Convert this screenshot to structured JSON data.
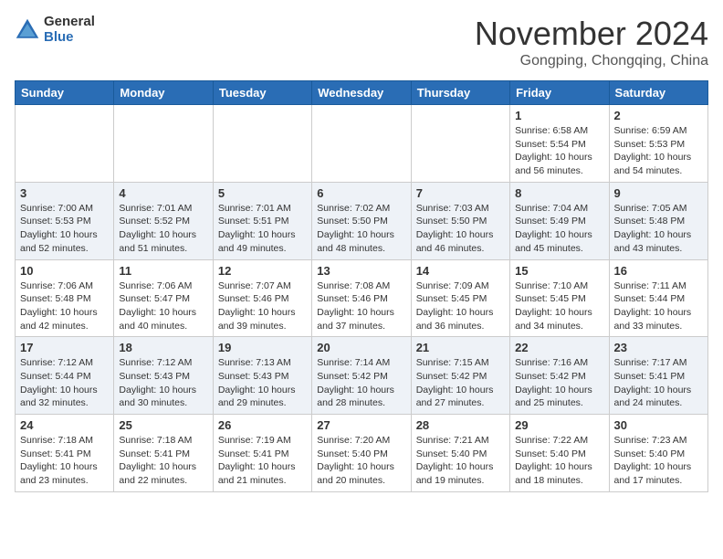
{
  "header": {
    "logo_general": "General",
    "logo_blue": "Blue",
    "month_title": "November 2024",
    "location": "Gongping, Chongqing, China"
  },
  "days_of_week": [
    "Sunday",
    "Monday",
    "Tuesday",
    "Wednesday",
    "Thursday",
    "Friday",
    "Saturday"
  ],
  "weeks": [
    {
      "alt": false,
      "days": [
        {
          "num": "",
          "info": ""
        },
        {
          "num": "",
          "info": ""
        },
        {
          "num": "",
          "info": ""
        },
        {
          "num": "",
          "info": ""
        },
        {
          "num": "",
          "info": ""
        },
        {
          "num": "1",
          "info": "Sunrise: 6:58 AM\nSunset: 5:54 PM\nDaylight: 10 hours and 56 minutes."
        },
        {
          "num": "2",
          "info": "Sunrise: 6:59 AM\nSunset: 5:53 PM\nDaylight: 10 hours and 54 minutes."
        }
      ]
    },
    {
      "alt": true,
      "days": [
        {
          "num": "3",
          "info": "Sunrise: 7:00 AM\nSunset: 5:53 PM\nDaylight: 10 hours and 52 minutes."
        },
        {
          "num": "4",
          "info": "Sunrise: 7:01 AM\nSunset: 5:52 PM\nDaylight: 10 hours and 51 minutes."
        },
        {
          "num": "5",
          "info": "Sunrise: 7:01 AM\nSunset: 5:51 PM\nDaylight: 10 hours and 49 minutes."
        },
        {
          "num": "6",
          "info": "Sunrise: 7:02 AM\nSunset: 5:50 PM\nDaylight: 10 hours and 48 minutes."
        },
        {
          "num": "7",
          "info": "Sunrise: 7:03 AM\nSunset: 5:50 PM\nDaylight: 10 hours and 46 minutes."
        },
        {
          "num": "8",
          "info": "Sunrise: 7:04 AM\nSunset: 5:49 PM\nDaylight: 10 hours and 45 minutes."
        },
        {
          "num": "9",
          "info": "Sunrise: 7:05 AM\nSunset: 5:48 PM\nDaylight: 10 hours and 43 minutes."
        }
      ]
    },
    {
      "alt": false,
      "days": [
        {
          "num": "10",
          "info": "Sunrise: 7:06 AM\nSunset: 5:48 PM\nDaylight: 10 hours and 42 minutes."
        },
        {
          "num": "11",
          "info": "Sunrise: 7:06 AM\nSunset: 5:47 PM\nDaylight: 10 hours and 40 minutes."
        },
        {
          "num": "12",
          "info": "Sunrise: 7:07 AM\nSunset: 5:46 PM\nDaylight: 10 hours and 39 minutes."
        },
        {
          "num": "13",
          "info": "Sunrise: 7:08 AM\nSunset: 5:46 PM\nDaylight: 10 hours and 37 minutes."
        },
        {
          "num": "14",
          "info": "Sunrise: 7:09 AM\nSunset: 5:45 PM\nDaylight: 10 hours and 36 minutes."
        },
        {
          "num": "15",
          "info": "Sunrise: 7:10 AM\nSunset: 5:45 PM\nDaylight: 10 hours and 34 minutes."
        },
        {
          "num": "16",
          "info": "Sunrise: 7:11 AM\nSunset: 5:44 PM\nDaylight: 10 hours and 33 minutes."
        }
      ]
    },
    {
      "alt": true,
      "days": [
        {
          "num": "17",
          "info": "Sunrise: 7:12 AM\nSunset: 5:44 PM\nDaylight: 10 hours and 32 minutes."
        },
        {
          "num": "18",
          "info": "Sunrise: 7:12 AM\nSunset: 5:43 PM\nDaylight: 10 hours and 30 minutes."
        },
        {
          "num": "19",
          "info": "Sunrise: 7:13 AM\nSunset: 5:43 PM\nDaylight: 10 hours and 29 minutes."
        },
        {
          "num": "20",
          "info": "Sunrise: 7:14 AM\nSunset: 5:42 PM\nDaylight: 10 hours and 28 minutes."
        },
        {
          "num": "21",
          "info": "Sunrise: 7:15 AM\nSunset: 5:42 PM\nDaylight: 10 hours and 27 minutes."
        },
        {
          "num": "22",
          "info": "Sunrise: 7:16 AM\nSunset: 5:42 PM\nDaylight: 10 hours and 25 minutes."
        },
        {
          "num": "23",
          "info": "Sunrise: 7:17 AM\nSunset: 5:41 PM\nDaylight: 10 hours and 24 minutes."
        }
      ]
    },
    {
      "alt": false,
      "days": [
        {
          "num": "24",
          "info": "Sunrise: 7:18 AM\nSunset: 5:41 PM\nDaylight: 10 hours and 23 minutes."
        },
        {
          "num": "25",
          "info": "Sunrise: 7:18 AM\nSunset: 5:41 PM\nDaylight: 10 hours and 22 minutes."
        },
        {
          "num": "26",
          "info": "Sunrise: 7:19 AM\nSunset: 5:41 PM\nDaylight: 10 hours and 21 minutes."
        },
        {
          "num": "27",
          "info": "Sunrise: 7:20 AM\nSunset: 5:40 PM\nDaylight: 10 hours and 20 minutes."
        },
        {
          "num": "28",
          "info": "Sunrise: 7:21 AM\nSunset: 5:40 PM\nDaylight: 10 hours and 19 minutes."
        },
        {
          "num": "29",
          "info": "Sunrise: 7:22 AM\nSunset: 5:40 PM\nDaylight: 10 hours and 18 minutes."
        },
        {
          "num": "30",
          "info": "Sunrise: 7:23 AM\nSunset: 5:40 PM\nDaylight: 10 hours and 17 minutes."
        }
      ]
    }
  ]
}
